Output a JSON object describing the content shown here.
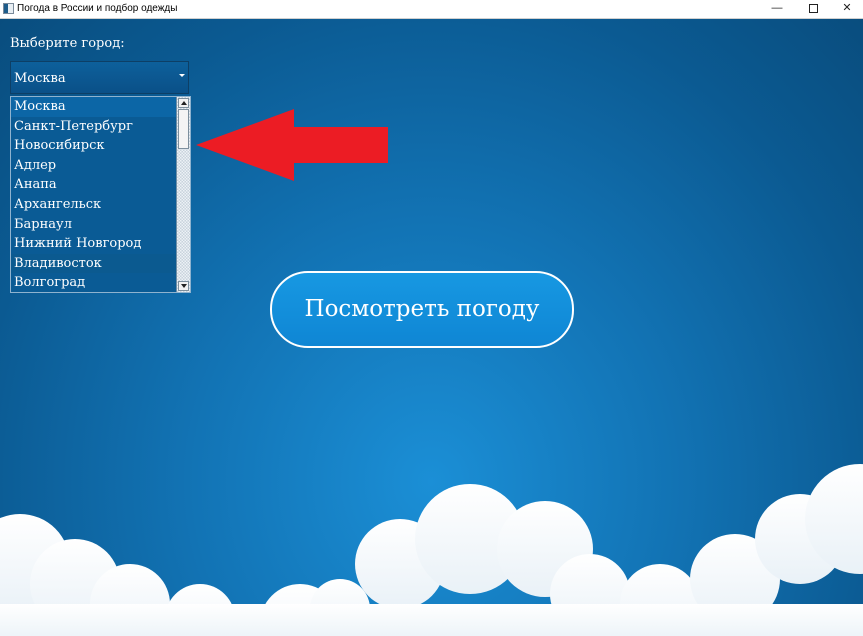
{
  "window": {
    "title": "Погода в России и подбор одежды",
    "controls": {
      "minimize": "—",
      "close": "✕"
    }
  },
  "form": {
    "city_label": "Выберите город:",
    "combo_value": "Москва",
    "cities": [
      "Москва",
      "Санкт-Петербург",
      "Новосибирск",
      "Адлер",
      "Анапа",
      "Архангельск",
      "Барнаул",
      "Нижний Новгород",
      "Владивосток",
      "Волгоград"
    ],
    "hovered_item": "Владивосток",
    "show_weather_button": "Посмотреть погоду"
  },
  "colors": {
    "sky_top": "#094d7e",
    "sky_center": "#1b8fd6",
    "arrow": "#ec1c24",
    "button_fill": "#1798e2",
    "cloud": "#ffffff"
  },
  "icons": [
    "app-icon",
    "red-arrow-icon",
    "chevron-down-icon",
    "scroll-up-icon",
    "scroll-down-icon"
  ]
}
